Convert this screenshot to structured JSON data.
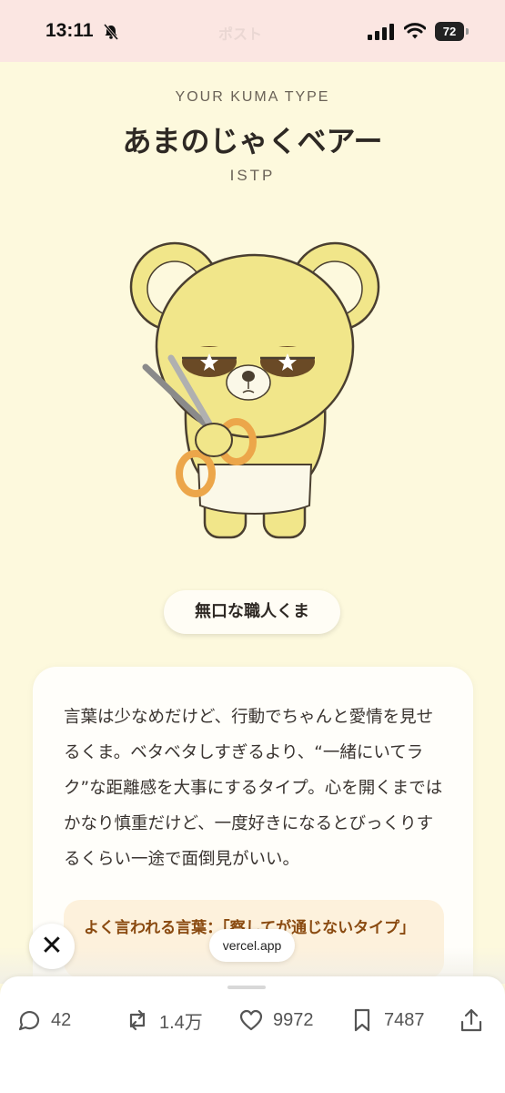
{
  "status_bar": {
    "time": "13:11",
    "faded_title": "ポスト",
    "battery": "72"
  },
  "result": {
    "kicker": "YOUR KUMA TYPE",
    "title": "あまのじゃくベアー",
    "code": "ISTP",
    "nickname": "無口な職人くま",
    "description": "言葉は少なめだけど、行動でちゃんと愛情を見せるくま。ベタベタしすぎるより、“一緒にいてラク”な距離感を大事にするタイプ。心を開くまではかなり慎重だけど、一度好きになるとびっくりするくらい一途で面倒見がいい。",
    "quote": "よく言われる言葉：「察してが通じないタイプ」"
  },
  "overlay": {
    "close": "✕",
    "url": "vercel.app"
  },
  "actions": {
    "replies": "42",
    "reposts": "1.4万",
    "likes": "9972",
    "bookmarks": "7487"
  },
  "colors": {
    "background": "#fdf9dd",
    "status_bar": "#fbe6e2",
    "bear": "#f1e68a",
    "quote_bg": "#fdf1dc",
    "quote_text": "#8a4a10"
  }
}
